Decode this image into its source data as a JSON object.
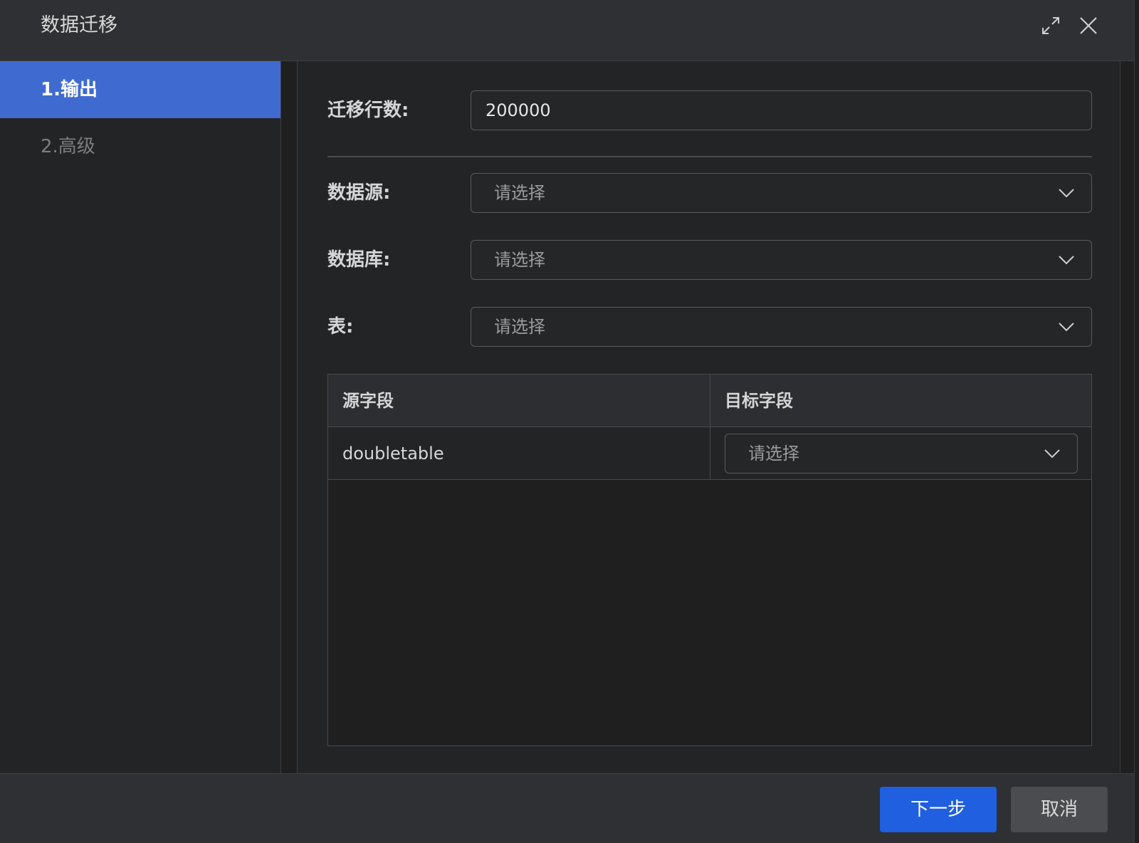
{
  "dialog": {
    "title": "数据迁移",
    "maximize_icon": "maximize-icon",
    "close_icon": "close-icon"
  },
  "sidebar": {
    "steps": [
      {
        "label": "1.输出",
        "active": true
      },
      {
        "label": "2.高级",
        "active": false
      }
    ]
  },
  "form": {
    "rows_label": "迁移行数:",
    "rows_value": "200000",
    "datasource_label": "数据源:",
    "datasource_placeholder": "请选择",
    "database_label": "数据库:",
    "database_placeholder": "请选择",
    "table_label": "表:",
    "table_placeholder": "请选择"
  },
  "mapping": {
    "headers": [
      "源字段",
      "目标字段"
    ],
    "rows": [
      {
        "source": "doubletable",
        "target_placeholder": "请选择"
      }
    ]
  },
  "footer": {
    "next_label": "下一步",
    "cancel_label": "取消"
  },
  "colors": {
    "accent": "#1f5fe0",
    "active_step": "#3f6bd1"
  }
}
